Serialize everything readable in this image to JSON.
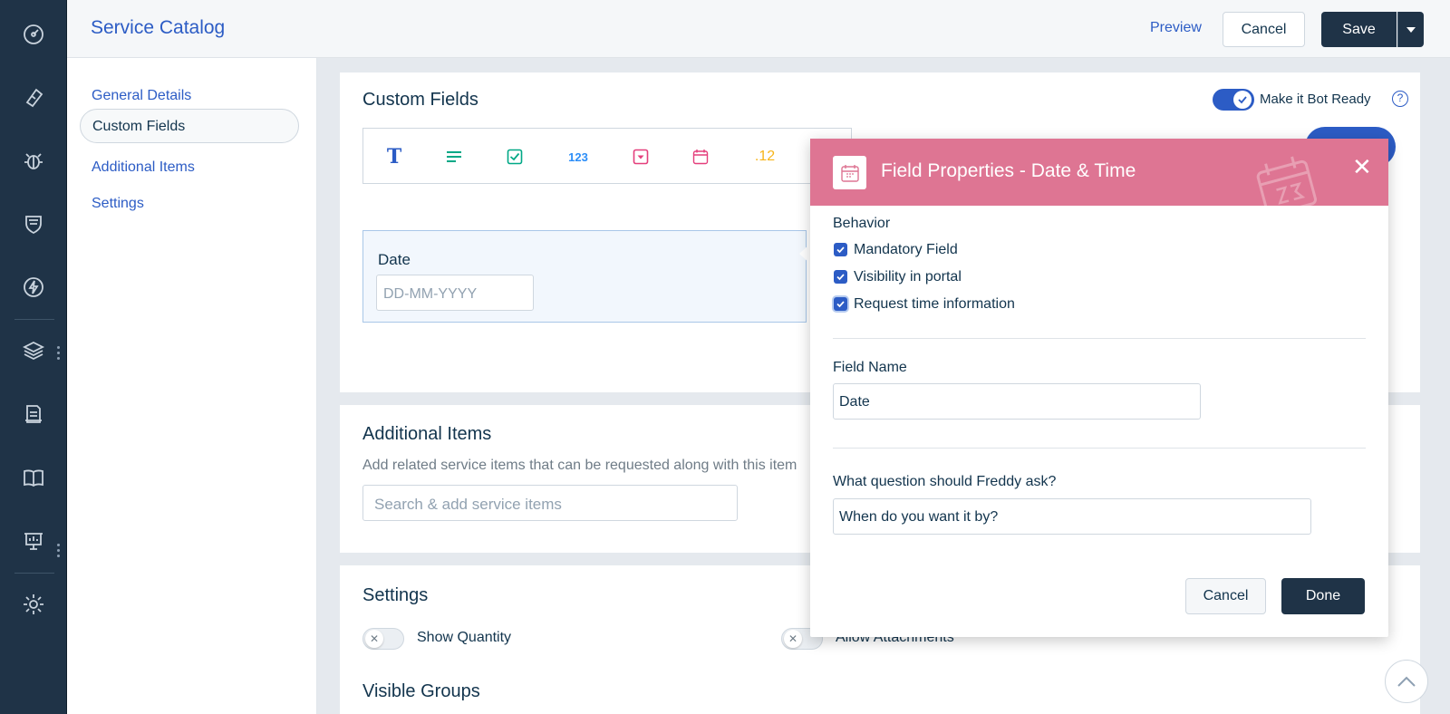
{
  "header": {
    "title": "Service Catalog",
    "preview": "Preview",
    "cancel": "Cancel",
    "save": "Save"
  },
  "leftnav": {
    "items": [
      {
        "label": "General Details"
      },
      {
        "label": "Custom Fields"
      },
      {
        "label": "Additional Items"
      },
      {
        "label": "Settings"
      }
    ]
  },
  "custom_fields": {
    "title": "Custom Fields",
    "bot_ready_label": "Make it Bot Ready",
    "bot_ready_enabled": true,
    "tools": [
      {
        "icon": "text-field-icon",
        "glyph": "T",
        "color": "#2c5cc5"
      },
      {
        "icon": "paragraph-icon",
        "glyph": "",
        "color": "#00a886"
      },
      {
        "icon": "checkbox-icon",
        "glyph": "",
        "color": "#00a886"
      },
      {
        "icon": "number-icon",
        "glyph": "123",
        "color": "#2c8ef8"
      },
      {
        "icon": "dropdown-icon",
        "glyph": "",
        "color": "#e43f7c"
      },
      {
        "icon": "date-icon",
        "glyph": "",
        "color": "#e43f7c"
      },
      {
        "icon": "decimal-icon",
        "glyph": ".12",
        "color": "#f7b51a"
      }
    ],
    "preview_field": {
      "label": "Date",
      "placeholder": "DD-MM-YYYY"
    }
  },
  "additional_items": {
    "title": "Additional Items",
    "description": "Add related service items that can be requested along with this item",
    "search_placeholder": "Search & add service items"
  },
  "settings": {
    "title": "Settings",
    "show_quantity": "Show Quantity",
    "allow_attachments": "Allow Attachments",
    "visible_groups": "Visible Groups"
  },
  "popup": {
    "title": "Field Properties - Date & Time",
    "accent": "#de7593",
    "behavior_label": "Behavior",
    "checks": [
      {
        "label": "Mandatory Field",
        "checked": true
      },
      {
        "label": "Visibility in portal",
        "checked": true
      },
      {
        "label": "Request time information",
        "checked": true
      }
    ],
    "field_name_label": "Field Name",
    "field_name_value": "Date",
    "question_label": "What question should Freddy ask?",
    "question_value": "When do you want it by?",
    "cancel": "Cancel",
    "done": "Done"
  },
  "rail": {
    "icons": [
      "dashboard-icon",
      "tickets-icon",
      "problems-icon",
      "changes-icon",
      "releases-icon",
      "assets-icon",
      "solutions-icon",
      "knowledge-icon",
      "reports-icon",
      "admin-gear-icon"
    ]
  }
}
